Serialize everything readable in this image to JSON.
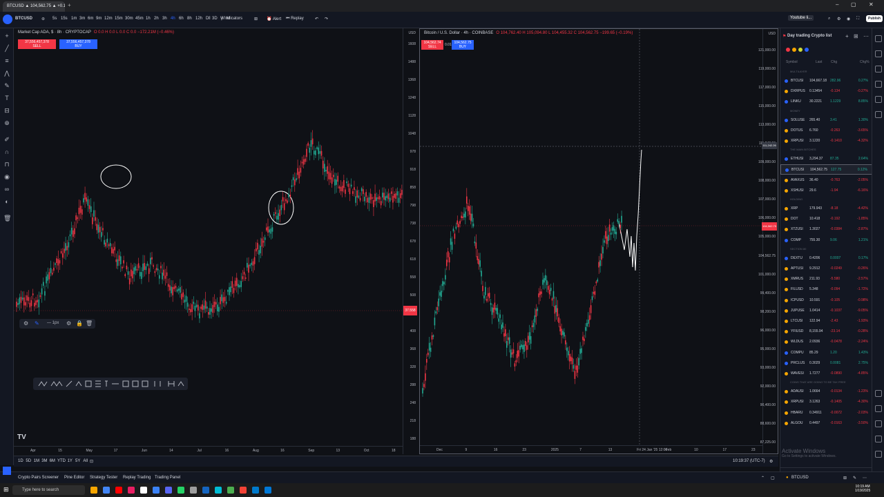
{
  "browser": {
    "tab_title": "BTCUSD ▲ 104,562.75 ▲ +0.12%"
  },
  "toolbar": {
    "symbol": "BTCUSD",
    "intervals": [
      "5s",
      "15s",
      "1m",
      "3m",
      "6m",
      "9m",
      "12m",
      "15m",
      "30m",
      "45m",
      "1h",
      "2h",
      "3h",
      "4h",
      "6h",
      "8h",
      "12h",
      "D",
      "3D",
      "W",
      "M"
    ],
    "indicators_label": "Indicators",
    "alert_label": "Alert",
    "replay_label": "Replay",
    "publish_label": "Publish",
    "watchlist_button": "Youtube li..."
  },
  "left_chart": {
    "legend_title": "Market Cap ADA, $ · 8h · CRYPTOCAP",
    "legend_values": "O 0.0 H 0.0 L 0.0 C 0.0 −172.21M (−0.46%)",
    "sell_price": "37,556,457,378",
    "sell_label": "SELL",
    "buy_price": "37,556,457,378",
    "buy_label": "BUY",
    "y_ticks": [
      "1608",
      "1488",
      "1368",
      "1248",
      "1128",
      "1048",
      "978",
      "918",
      "858",
      "798",
      "738",
      "678",
      "618",
      "558",
      "508",
      "458",
      "408",
      "368",
      "328",
      "288",
      "248",
      "218",
      "188"
    ],
    "y_ticks_unit": "",
    "last_price_label": "37.558",
    "x_ticks": [
      "Apr",
      "15",
      "May",
      "17",
      "Jun",
      "14",
      "Jul",
      "16",
      "Aug",
      "16",
      "Sep",
      "13",
      "Oct",
      "18"
    ],
    "axis_unit_top": "USD"
  },
  "right_chart": {
    "legend_title": "Bitcoin / U.S. Dollar · 4h · COINBASE",
    "legend_values": "O 104,762.40 H 105,094.80 L 104,455.32 C 104,562.75 −199.65 (−0.19%)",
    "sell_price": "104,562.74",
    "sell_label": "SELL",
    "spread": "0.01",
    "buy_price": "104,562.75",
    "buy_label": "BUY",
    "y_ticks": [
      "121,000.00",
      "119,000.00",
      "117,000.00",
      "115,000.00",
      "113,000.00",
      "111,242.26",
      "109,000.00",
      "108,000.00",
      "107,000.00",
      "106,000.00",
      "105,000.00",
      "104,562.75",
      "101,000.00",
      "99,400.00",
      "98,200.00",
      "96,000.00",
      "95,000.00",
      "93,000.00",
      "92,000.00",
      "90,400.00",
      "88,600.00",
      "87,225.00"
    ],
    "crosshair_price": "111,242.26",
    "last_price": "104,562.75",
    "x_ticks": [
      "Dec",
      "9",
      "16",
      "23",
      "2025",
      "7",
      "13",
      "Fri 24 Jan '25 12:00",
      "Feb",
      "10",
      "17",
      "23"
    ],
    "axis_unit_top": "USD"
  },
  "range_bar": {
    "ranges": [
      "1D",
      "5D",
      "1M",
      "3M",
      "6M",
      "YTD",
      "1Y",
      "5Y",
      "All"
    ],
    "clock": "10:19:37 (UTC-7)"
  },
  "bottom_panel": {
    "tabs": [
      "Crypto Pairs Screener",
      "Pine Editor",
      "Strategy Tester",
      "Replay Trading",
      "Trading Panel"
    ]
  },
  "watchlist": {
    "title": "Day trading Crypto list",
    "headers": [
      "Symbol",
      "Last",
      "Chg",
      "Chg%"
    ],
    "sections": [
      {
        "name": "MULTILAYER",
        "rows": [
          {
            "sym": "BTCUSI",
            "last": "104,667.18",
            "chg": "282.96",
            "chgp": "0.27%",
            "dir": "up"
          },
          {
            "sym": "DXRPUS",
            "last": "0.13454",
            "chg": "-0.134",
            "chgp": "-0.27%",
            "dir": "dn"
          },
          {
            "sym": "LINKU",
            "last": "30.2221",
            "chg": "1.1229",
            "chgp": "8.85%",
            "dir": "up"
          }
        ]
      },
      {
        "name": "MONEY",
        "rows": [
          {
            "sym": "SOLUSE",
            "last": "265.40",
            "chg": "3.41",
            "chgp": "1.30%",
            "dir": "up"
          },
          {
            "sym": "DOTUS",
            "last": "6.760",
            "chg": "-0.263",
            "chgp": "-3.65%",
            "dir": "dn"
          },
          {
            "sym": "XRPUSI",
            "last": "3.1220",
            "chg": "-0.1410",
            "chgp": "-4.32%",
            "dir": "dn"
          }
        ]
      },
      {
        "name": "THE MAIN BITCHES",
        "rows": [
          {
            "sym": "ETHUSI",
            "last": "3,294.37",
            "chg": "87.35",
            "chgp": "2.64%",
            "dir": "up"
          },
          {
            "sym": "BTCUSI",
            "last": "104,562.75",
            "chg": "127.75",
            "chgp": "0.12%",
            "dir": "up"
          },
          {
            "sym": "AVAXUS",
            "last": "36.40",
            "chg": "-0.763",
            "chgp": "-2.05%",
            "dir": "dn"
          },
          {
            "sym": "XSHUSI",
            "last": "29.6",
            "chg": "-1.94",
            "chgp": "-6.16%",
            "dir": "dn"
          }
        ]
      },
      {
        "name": "HOLDING",
        "rows": [
          {
            "sym": "XRP",
            "last": "179.943",
            "chg": "-8.18",
            "chgp": "-4.42%",
            "dir": "dn"
          },
          {
            "sym": "DOT",
            "last": "10.418",
            "chg": "-0.192",
            "chgp": "-1.85%",
            "dir": "dn"
          },
          {
            "sym": "XTZUSI",
            "last": "1.3027",
            "chg": "-0.0384",
            "chgp": "-2.87%",
            "dir": "dn"
          },
          {
            "sym": "COMP",
            "last": "755.30",
            "chg": "9.06",
            "chgp": "1.21%",
            "dir": "up"
          }
        ]
      },
      {
        "name": "SECTION 80",
        "rows": [
          {
            "sym": "DEXTU",
            "last": "0.4206",
            "chg": "0.0007",
            "chgp": "0.17%",
            "dir": "up"
          },
          {
            "sym": "APTUSI",
            "last": "9.2912",
            "chg": "-0.0249",
            "chgp": "-0.26%",
            "dir": "dn"
          },
          {
            "sym": "XMRUS",
            "last": "211.93",
            "chg": "-5.580",
            "chgp": "-2.57%",
            "dir": "dn"
          },
          {
            "sym": "FILUSD",
            "last": "5.348",
            "chg": "-0.094",
            "chgp": "-1.72%",
            "dir": "dn"
          },
          {
            "sym": "ICPUSD",
            "last": "10.591",
            "chg": "-0.105",
            "chgp": "-0.98%",
            "dir": "dn"
          },
          {
            "sym": "JUPUSE",
            "last": "1.0414",
            "chg": "-0.1037",
            "chgp": "-9.05%",
            "dir": "dn"
          },
          {
            "sym": "LTCUSI",
            "last": "122.94",
            "chg": "-2.43",
            "chgp": "-1.93%",
            "dir": "dn"
          },
          {
            "sym": "YFIUSD",
            "last": "8,155.94",
            "chg": "-23.14",
            "chgp": "-0.28%",
            "dir": "dn"
          },
          {
            "sym": "WLDUS",
            "last": "2.0936",
            "chg": "-0.0478",
            "chgp": "-2.24%",
            "dir": "dn"
          },
          {
            "sym": "COMPU",
            "last": "85.29",
            "chg": "1.20",
            "chgp": "1.43%",
            "dir": "up"
          },
          {
            "sym": "PRCLUS",
            "last": "0.3029",
            "chg": "0.0081",
            "chgp": "2.75%",
            "dir": "up"
          },
          {
            "sym": "WAVESI",
            "last": "1.7277",
            "chg": "-0.0890",
            "chgp": "-4.85%",
            "dir": "dn"
          }
        ]
      },
      {
        "name": "COINS THAT ARE GOING TO BE TAX FREE",
        "rows": [
          {
            "sym": "ADAUSI",
            "last": "1.0664",
            "chg": "-0.0134",
            "chgp": "-1.23%",
            "dir": "dn"
          },
          {
            "sym": "XRPUSI",
            "last": "3.1263",
            "chg": "-0.1405",
            "chgp": "-4.30%",
            "dir": "dn"
          },
          {
            "sym": "HBARU",
            "last": "0.34911",
            "chg": "-0.0072",
            "chgp": "-2.03%",
            "dir": "dn"
          },
          {
            "sym": "ALGOU",
            "last": "0.4497",
            "chg": "-0.0163",
            "chgp": "-3.50%",
            "dir": "dn"
          }
        ]
      }
    ],
    "footer_symbol": "BTCUSD"
  },
  "activation": {
    "line1": "Activate Windows",
    "line2": "Go to Settings to activate Windows."
  },
  "taskbar": {
    "search_placeholder": "Type here to search",
    "time": "10:19 AM",
    "date": "1/19/2025"
  },
  "colors": {
    "up": "#22ab94",
    "down": "#f23645",
    "background": "#0f1116",
    "panel": "#131722",
    "accent": "#2962ff"
  }
}
